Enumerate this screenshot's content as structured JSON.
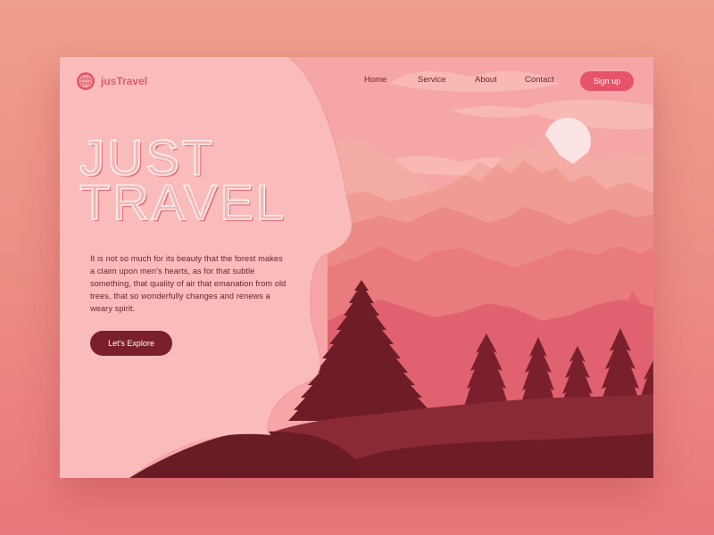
{
  "brand": {
    "name": "jusTravel",
    "icon": "globe-icon"
  },
  "nav": {
    "items": [
      {
        "label": "Home"
      },
      {
        "label": "Service"
      },
      {
        "label": "About"
      },
      {
        "label": "Contact"
      }
    ],
    "signup_label": "Sign up"
  },
  "hero": {
    "title_line1": "JUST",
    "title_line2": "TRAVEL",
    "description": "It is not so much for its beauty that the forest makes a claim upon men's hearts, as for that subtle something, that quality of air that emanation from old trees, that so wonderfully changes and renews a weary spirit.",
    "cta_label": "Let's Explore"
  },
  "colors": {
    "page_background": "#ec8c82",
    "card_panel": "#f9bcbb",
    "brand_accent": "#e35a6b",
    "signup_button": "#e6536b",
    "cta_button": "#7a1f2c",
    "dark_forest": "#6e1d26",
    "sun": "#fbe4e3"
  }
}
